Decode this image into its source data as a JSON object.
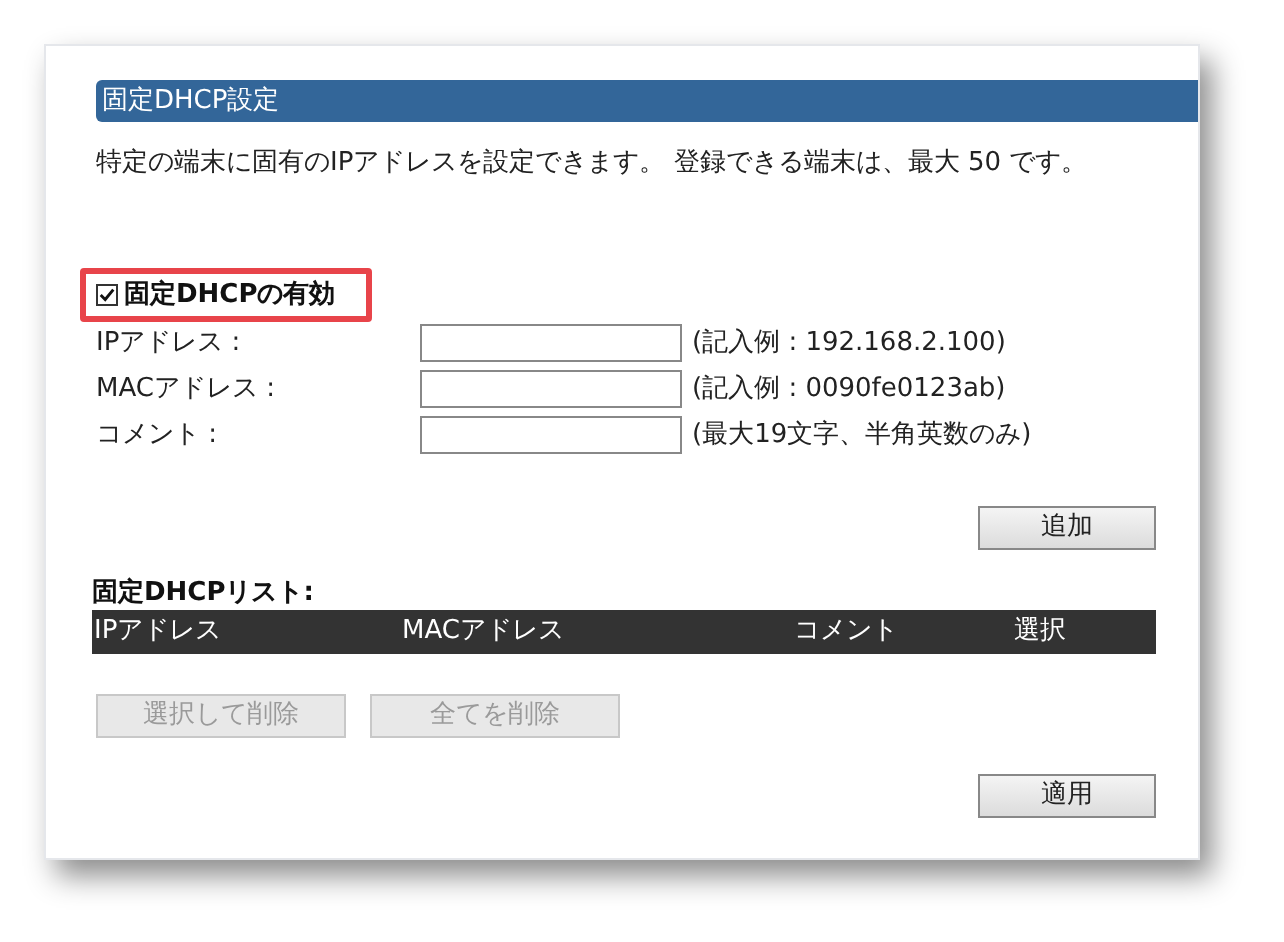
{
  "section_title": "固定DHCP設定",
  "description": "特定の端末に固有のIPアドレスを設定できます。 登録できる端末は、最大 50 です。",
  "enable": {
    "label": "固定DHCPの有効",
    "checked": true
  },
  "fields": [
    {
      "label": "IPアドレス :",
      "hint": "(記入例 : 192.168.2.100)"
    },
    {
      "label": "MACアドレス :",
      "hint": "(記入例 : 0090fe0123ab)"
    },
    {
      "label": "コメント :",
      "hint": "(最大19文字、半角英数のみ)"
    }
  ],
  "add_button": "追加",
  "list_title": "固定DHCPリスト:",
  "table": {
    "columns": [
      "IPアドレス",
      "MACアドレス",
      "コメント",
      "選択"
    ]
  },
  "list_buttons": [
    {
      "label": "選択して削除",
      "disabled": true
    },
    {
      "label": "全てを削除",
      "disabled": true
    }
  ],
  "apply_button": "適用"
}
